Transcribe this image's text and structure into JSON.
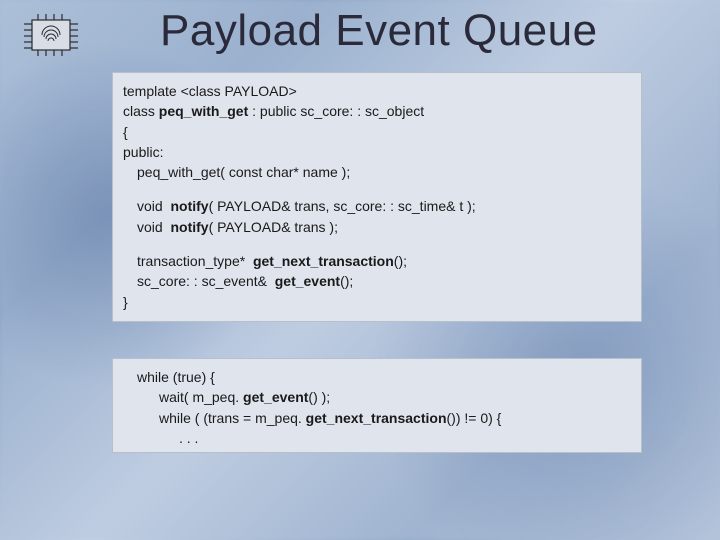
{
  "title": "Payload Event Queue",
  "icon": "fingerprint-chip-icon",
  "box1": {
    "l1a": "template <class PAYLOAD>",
    "l2a": "class ",
    "l2b": "peq_with_get",
    "l2c": " : public sc_core: : sc_object",
    "l3": "{",
    "l4": "public:",
    "l5": "peq_with_get( const char* name );",
    "l6a": "void  ",
    "l6b": "notify",
    "l6c": "( PAYLOAD& trans, sc_core: : sc_time& t );",
    "l7a": "void  ",
    "l7b": "notify",
    "l7c": "( PAYLOAD& trans );",
    "l8a": "transaction_type*  ",
    "l8b": "get_next_transaction",
    "l8c": "();",
    "l9a": "sc_core: : sc_event&  ",
    "l9b": "get_event",
    "l9c": "();",
    "l10": "}"
  },
  "box2": {
    "l1": "while (true) {",
    "l2a": "wait( m_peq. ",
    "l2b": "get_event",
    "l2c": "() );",
    "l3a": "while ( (trans = m_peq. ",
    "l3b": "get_next_transaction",
    "l3c": "()) != 0) {",
    "l4": ". . ."
  }
}
